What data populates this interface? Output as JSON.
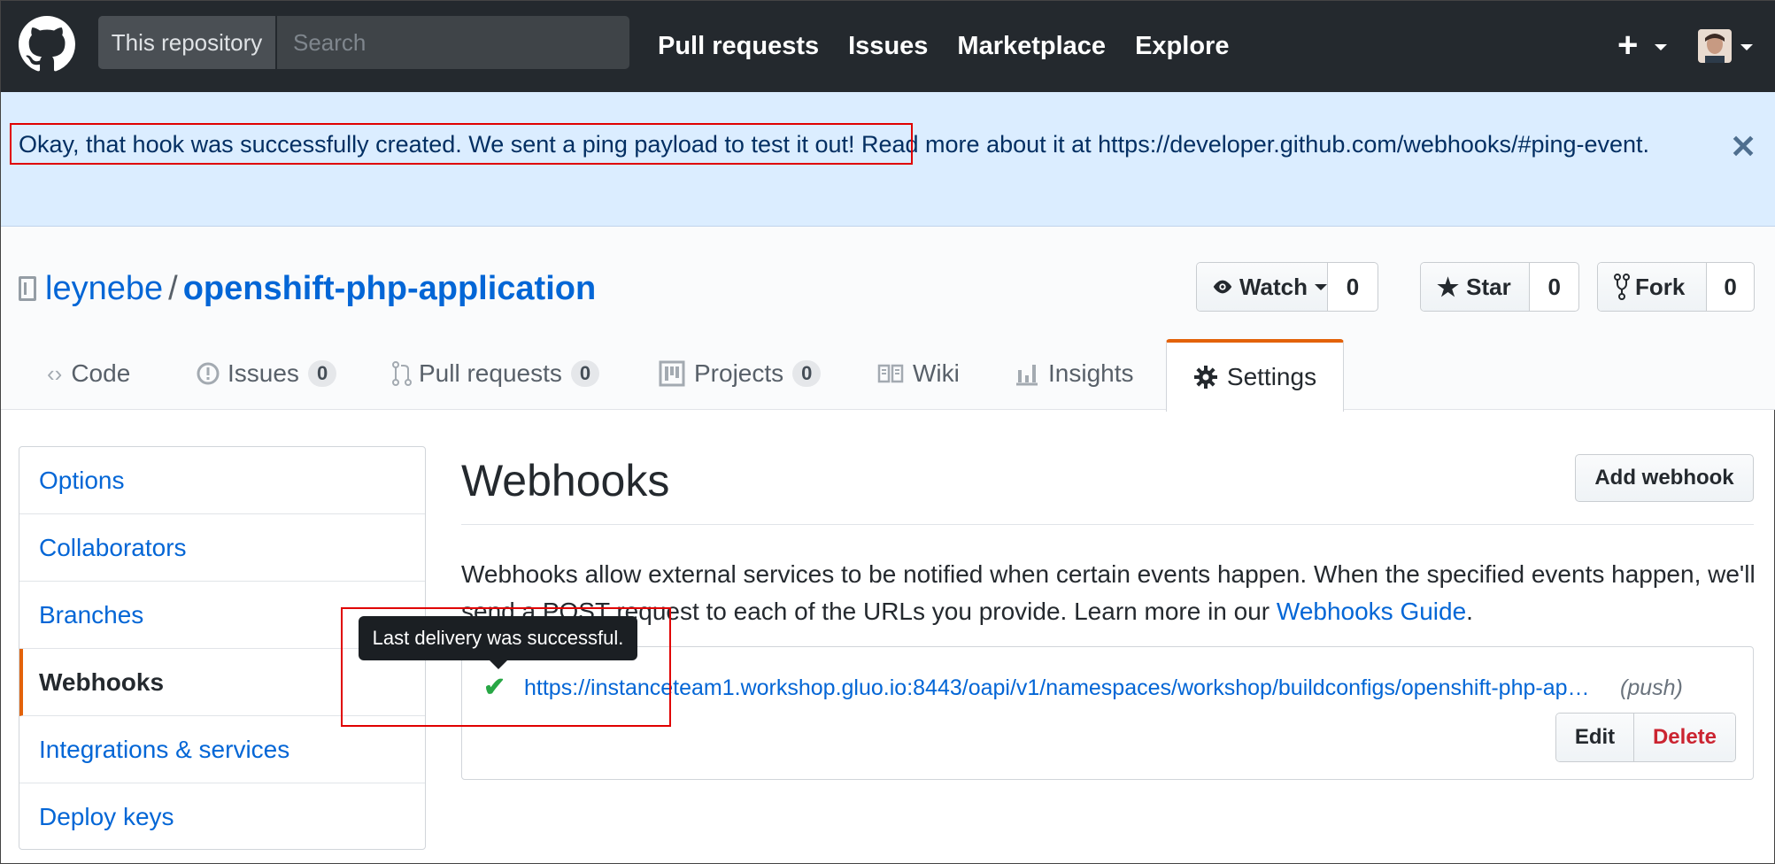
{
  "header": {
    "search_scope": "This repository",
    "search_placeholder": "Search",
    "nav": [
      "Pull requests",
      "Issues",
      "Marketplace",
      "Explore"
    ],
    "new_label": "+"
  },
  "flash": {
    "message_highlighted": "Okay, that hook was successfully created. We sent a ping payload to test it out!",
    "message_rest": " Read more about it at https://developer.github.com/webhooks/#ping-event.",
    "close_label": "✕"
  },
  "repo": {
    "owner": "leynebe",
    "separator": "/",
    "name": "openshift-php-application",
    "watch_label": "Watch",
    "watch_count": "0",
    "star_label": "Star",
    "star_count": "0",
    "fork_label": "Fork",
    "fork_count": "0"
  },
  "tabs": {
    "code": "Code",
    "issues": "Issues",
    "issues_count": "0",
    "pulls": "Pull requests",
    "pulls_count": "0",
    "projects": "Projects",
    "projects_count": "0",
    "wiki": "Wiki",
    "insights": "Insights",
    "settings": "Settings"
  },
  "sidebar": {
    "items": [
      "Options",
      "Collaborators",
      "Branches",
      "Webhooks",
      "Integrations & services",
      "Deploy keys"
    ],
    "selected": "Webhooks"
  },
  "main": {
    "title": "Webhooks",
    "add_button": "Add webhook",
    "description": "Webhooks allow external services to be notified when certain events happen. When the specified events happen, we'll send a POST request to each of the URLs you provide. Learn more in our ",
    "guide_link": "Webhooks Guide",
    "period": "."
  },
  "hook": {
    "url": "https://instanceteam1.workshop.gluo.io:8443/oapi/v1/namespaces/workshop/buildconfigs/openshift-php-ap…",
    "event": "(push)",
    "edit_label": "Edit",
    "delete_label": "Delete",
    "status_icon": "check-icon",
    "tooltip": "Last delivery was successful."
  },
  "colors": {
    "header_bg": "#24292e",
    "flash_bg": "#dbedff",
    "link": "#0366d6",
    "accent": "#e36209",
    "success": "#28a745",
    "danger": "#cb2431",
    "annotation": "#e00000"
  }
}
